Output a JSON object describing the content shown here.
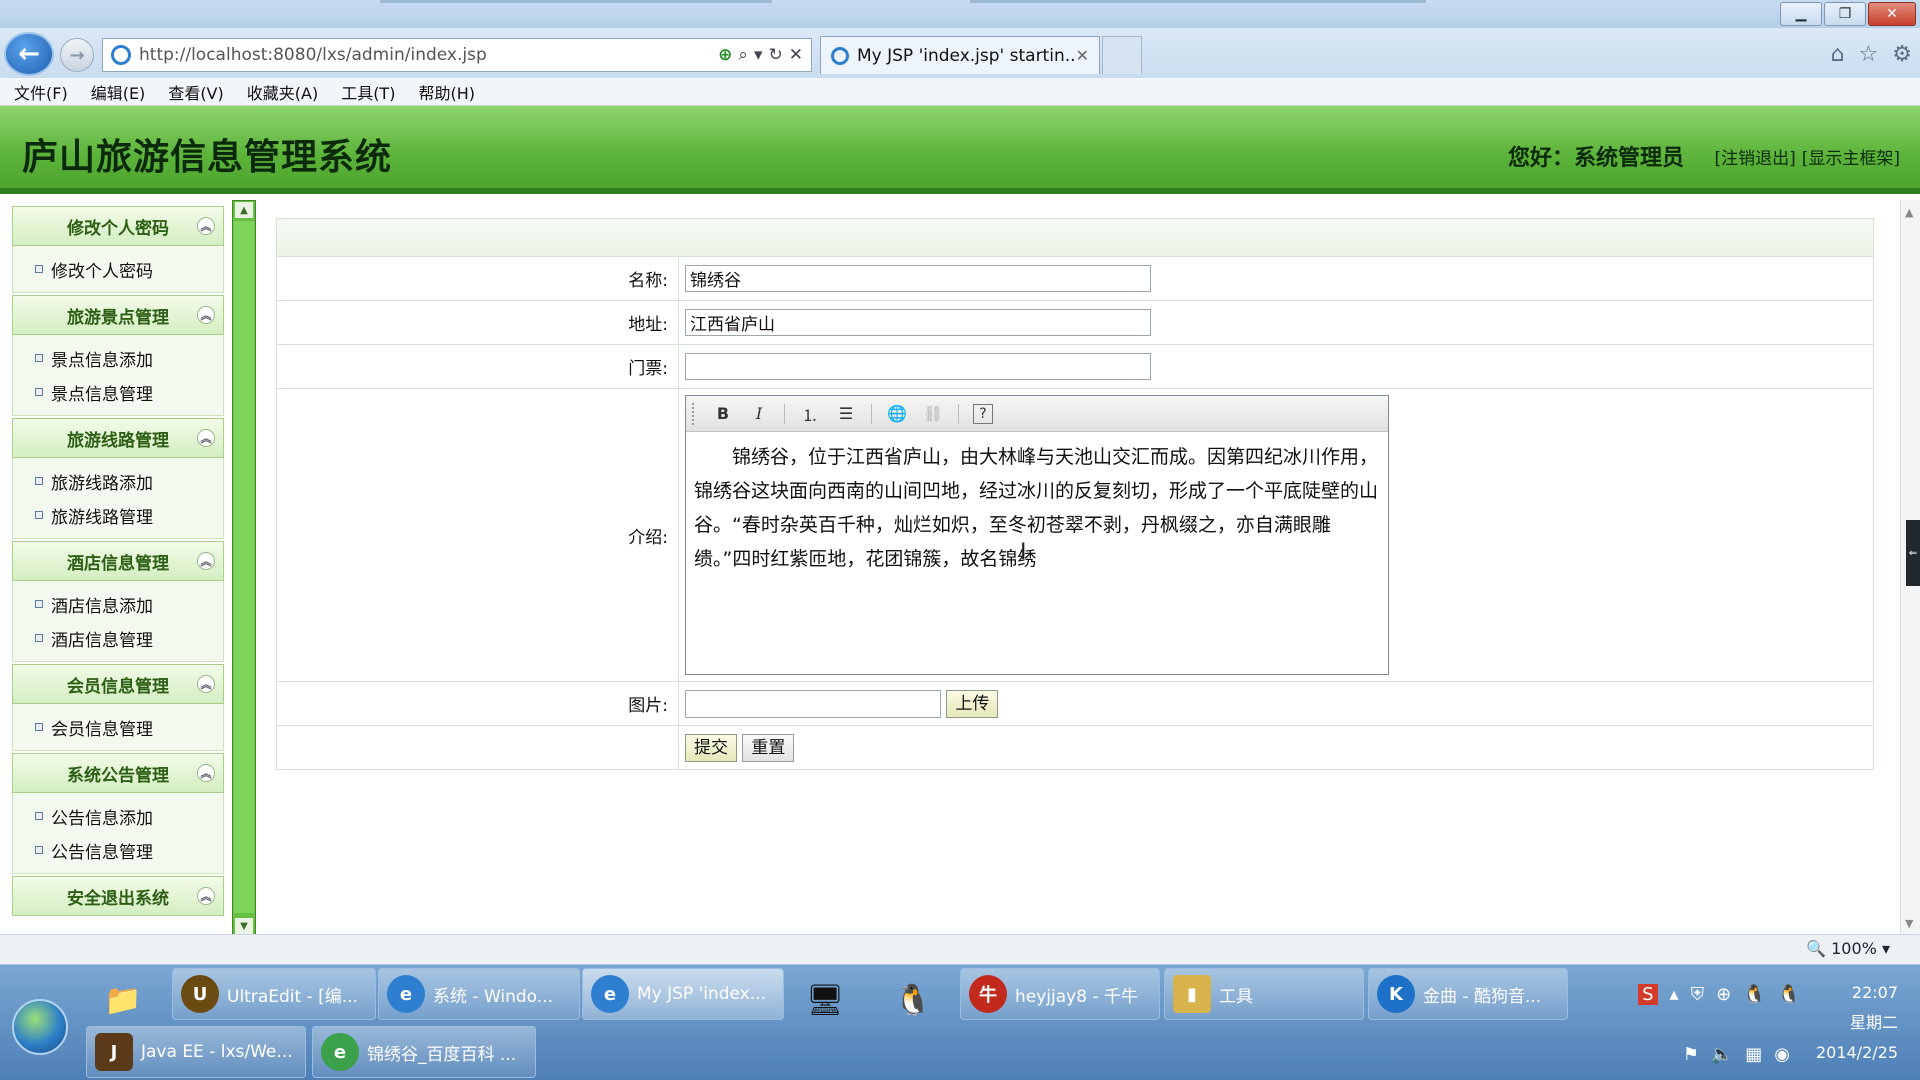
{
  "browser": {
    "url": "http://localhost:8080/lxs/admin/index.jsp",
    "tab_title": "My JSP 'index.jsp' startin...",
    "tab_close": "✕",
    "menus": [
      "文件(F)",
      "编辑(E)",
      "查看(V)",
      "收藏夹(A)",
      "工具(T)",
      "帮助(H)"
    ],
    "zoom": "100%"
  },
  "header": {
    "title": "庐山旅游信息管理系统",
    "greeting": "您好：系统管理员",
    "logout_link": "[注销退出]",
    "frame_link": "[显示主框架]"
  },
  "sidebar": {
    "groups": [
      {
        "title": "修改个人密码",
        "items": [
          "修改个人密码"
        ]
      },
      {
        "title": "旅游景点管理",
        "items": [
          "景点信息添加",
          "景点信息管理"
        ]
      },
      {
        "title": "旅游线路管理",
        "items": [
          "旅游线路添加",
          "旅游线路管理"
        ]
      },
      {
        "title": "酒店信息管理",
        "items": [
          "酒店信息添加",
          "酒店信息管理"
        ]
      },
      {
        "title": "会员信息管理",
        "items": [
          "会员信息管理"
        ]
      },
      {
        "title": "系统公告管理",
        "items": [
          "公告信息添加",
          "公告信息管理"
        ]
      },
      {
        "title": "安全退出系统",
        "items": []
      }
    ]
  },
  "form": {
    "name_label": "名称:",
    "name_value": "锦绣谷",
    "address_label": "地址:",
    "address_value": "江西省庐山",
    "ticket_label": "门票:",
    "ticket_value": "",
    "intro_label": "介绍:",
    "intro_text": "锦绣谷，位于江西省庐山，由大林峰与天池山交汇而成。因第四纪冰川作用，锦绣谷这块面向西南的山间凹地，经过冰川的反复刻切，形成了一个平底陡壁的山谷。“春时杂英百千种，灿烂如炽，至冬初苍翠不剥，丹枫缀之，亦自满眼雕缋。”四时红紫匝地，花团锦簇，故名锦绣",
    "image_label": "图片:",
    "upload_button": "上传",
    "submit_button": "提交",
    "reset_button": "重置"
  },
  "taskbar": {
    "tasks": [
      {
        "label": "UltraEdit - [编...",
        "icon": "U",
        "color": "#6b4b12"
      },
      {
        "label": "系统 - Windo...",
        "icon": "e",
        "color": "#2f7fd1"
      },
      {
        "label": "My JSP 'index...",
        "icon": "e",
        "color": "#2f7fd1"
      },
      {
        "label": "heyjjay8 - 千牛",
        "icon": "牛",
        "color": "#c22a1e"
      },
      {
        "label": "工具",
        "icon": "▮",
        "color": "#d8b24a"
      },
      {
        "label": "金曲 - 酷狗音...",
        "icon": "K",
        "color": "#1d71c8"
      },
      {
        "label": "Java EE - lxs/We...",
        "icon": "J",
        "color": "#5b3a1a"
      },
      {
        "label": "锦绣谷_百度百科 ...",
        "icon": "e",
        "color": "#3aa04a"
      }
    ],
    "time": "22:07",
    "weekday": "星期二",
    "date": "2014/2/25"
  }
}
